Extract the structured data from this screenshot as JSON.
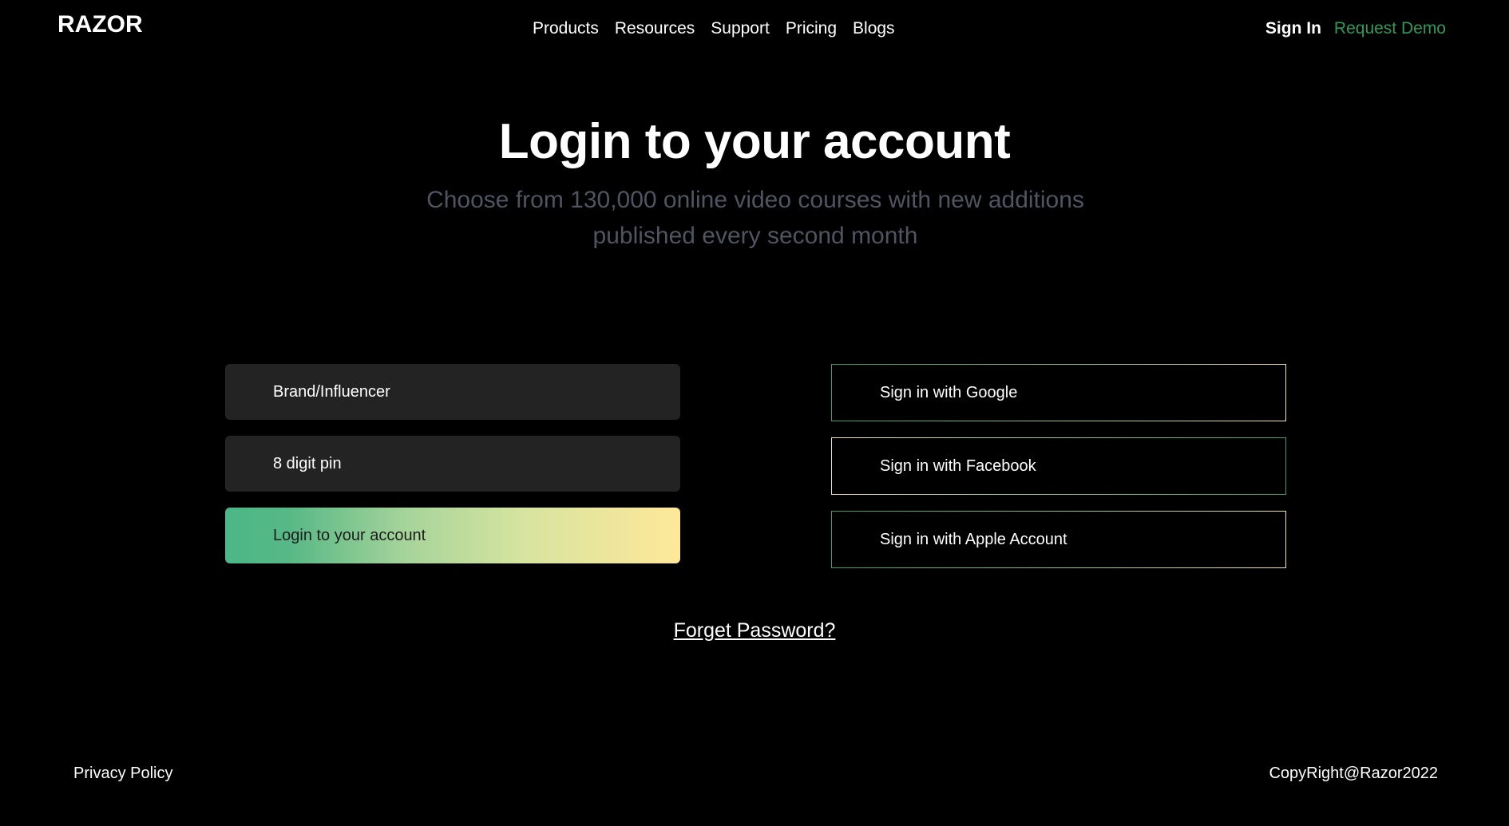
{
  "header": {
    "logo": "RAZOR",
    "nav": [
      "Products",
      "Resources",
      "Support",
      "Pricing",
      "Blogs"
    ],
    "sign_in": "Sign In",
    "request_demo": "Request Demo"
  },
  "hero": {
    "title": "Login to your account",
    "subtitle": "Choose from 130,000 online video courses with new additions published every second month"
  },
  "form": {
    "role_field": "Brand/Influencer",
    "pin_field": "8 digit pin",
    "login_button": "Login to your account"
  },
  "social": {
    "google": "Sign in with Google",
    "facebook": "Sign in with Facebook",
    "apple": "Sign in with Apple Account"
  },
  "forget_password": "Forget Password?",
  "footer": {
    "privacy": "Privacy Policy",
    "copyright": "CopyRight@Razor2022"
  },
  "colors": {
    "background": "#000000",
    "accent_green": "#2f9a5a",
    "gradient_start": "#4bb787",
    "gradient_end": "#ffe89a",
    "field_bg": "#232323",
    "subtitle": "#4f5560"
  }
}
